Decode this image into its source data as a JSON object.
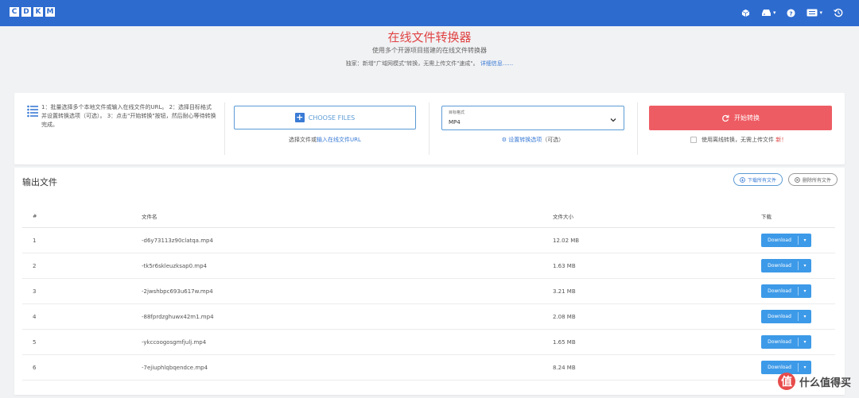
{
  "navbar": {
    "logo_letters": [
      "C",
      "D",
      "K",
      "M"
    ],
    "icons": [
      "cube-icon",
      "save-dropdown-icon",
      "help-icon",
      "language-dropdown-icon",
      "history-icon"
    ],
    "accent": "#2d6bcf"
  },
  "header": {
    "title": "在线文件转换器",
    "subtitle": "使用多个开源项目搭建的在线文件转换器",
    "notice": "独家：新增\"广域网模式\"转换，无需上传文件\"速成\"。",
    "notice_link": "详细信息......"
  },
  "upload_panel": {
    "instructions": "1：批量选择多个本地文件或输入在线文件的URL。 2：选择目标格式并设置转换选项（可选）。 3：点击\"开始转换\"按钮，然后耐心等待转换完成。",
    "choose_files_label": "CHOOSE FILES",
    "choose_hint_prefix": "选择文件或",
    "choose_hint_link": "输入在线文件URL",
    "format_label": "目标格式",
    "format_value": "MP4",
    "settings_link": "设置转换选项",
    "settings_suffix": "（可选）",
    "convert_label": "开始转换",
    "online_option": "使用离线转换，无需上传文件",
    "online_option_highlight": "新！"
  },
  "output": {
    "title": "输出文件",
    "download_all_label": "下载所有文件",
    "clear_all_label": "删除所有文件",
    "columns": [
      "#",
      "文件名",
      "文件大小",
      "下载"
    ],
    "download_label": "Download",
    "rows": [
      {
        "idx": "1",
        "name": "-d6y73113z90clatqa.mp4",
        "size": "12.02 MB"
      },
      {
        "idx": "2",
        "name": "-tk5r6skleuzksap0.mp4",
        "size": "1.63 MB"
      },
      {
        "idx": "3",
        "name": "-2jwshbpc693u617w.mp4",
        "size": "3.21 MB"
      },
      {
        "idx": "4",
        "name": "-88fprdzghuwx42m1.mp4",
        "size": "2.08 MB"
      },
      {
        "idx": "5",
        "name": "-ykccoogosgmfjulj.mp4",
        "size": "1.65 MB"
      },
      {
        "idx": "6",
        "name": "-7ejiuphlqbqendce.mp4",
        "size": "8.24 MB"
      }
    ]
  },
  "watermark": {
    "badge": "值",
    "text": "什么值得买"
  },
  "colors": {
    "title_red": "#e04343",
    "convert_red": "#ee5c63",
    "link_blue": "#3a7bd5",
    "download_blue": "#3d9ae8"
  }
}
